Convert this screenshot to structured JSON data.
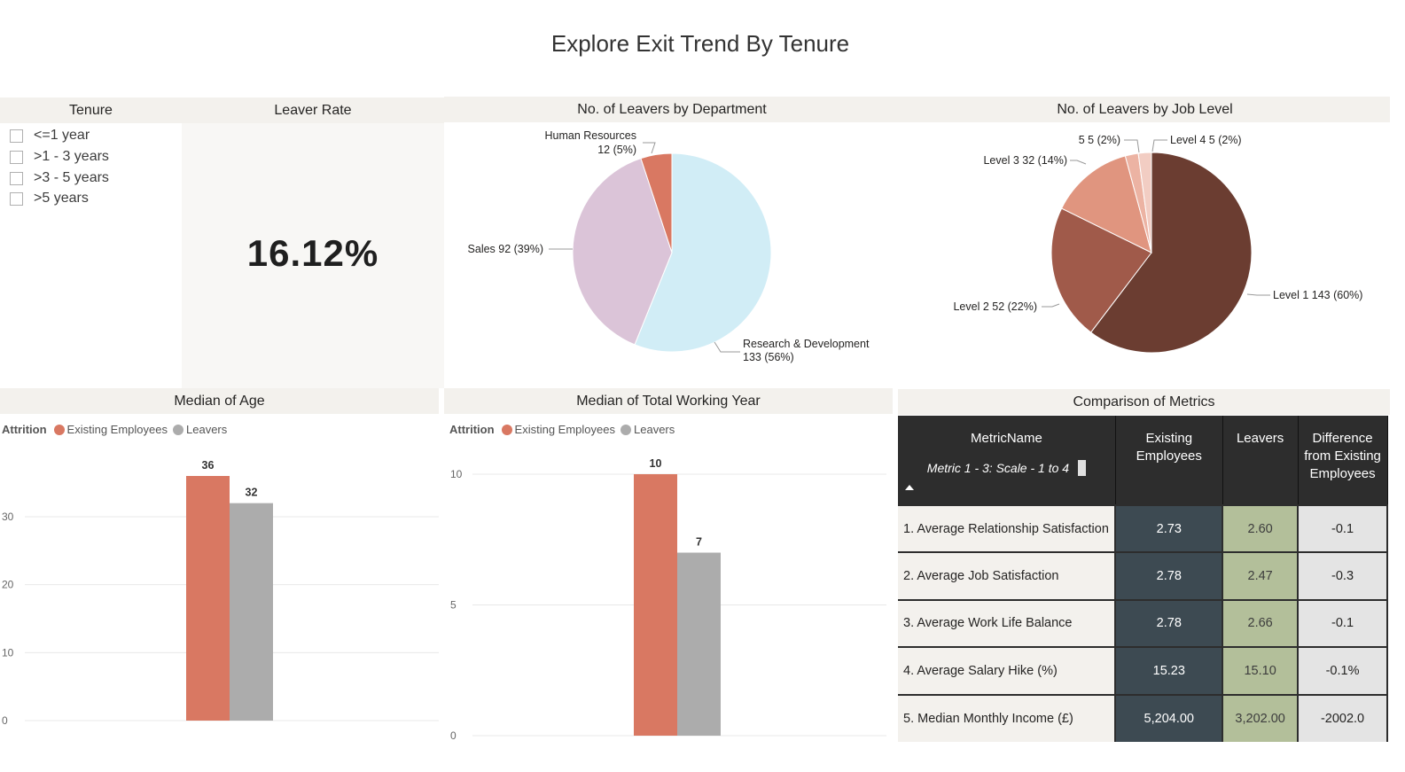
{
  "page": {
    "title": "Explore Exit Trend By Tenure"
  },
  "tenure": {
    "title": "Tenure",
    "options": [
      "<=1 year",
      ">1 - 3 years",
      ">3 - 5 years",
      ">5 years"
    ]
  },
  "leaver_rate": {
    "title": "Leaver Rate",
    "value": "16.12%"
  },
  "panels": {
    "dept_title": "No. of Leavers by Department",
    "level_title": "No. of Leavers by Job Level",
    "age_title": "Median of Age",
    "years_title": "Median of Total Working Year",
    "metrics_title": "Comparison of Metrics"
  },
  "legend": {
    "title": "Attrition",
    "existing": "Existing Employees",
    "leavers": "Leavers",
    "existing_color": "#d97862",
    "leavers_color": "#acacac"
  },
  "chart_data": [
    {
      "type": "pie",
      "title": "No. of Leavers by Department",
      "slices": [
        {
          "label": "Research & Development",
          "value": 133,
          "percent": "56%",
          "color": "#d1edf6",
          "text": "Research & Development",
          "text2": "133 (56%)"
        },
        {
          "label": "Sales",
          "value": 92,
          "percent": "39%",
          "color": "#dbc4d8",
          "text": "Sales 92 (39%)"
        },
        {
          "label": "Human Resources",
          "value": 12,
          "percent": "5%",
          "color": "#d97862",
          "text": "Human Resources",
          "text2": "12 (5%)"
        }
      ]
    },
    {
      "type": "pie",
      "title": "No. of Leavers by Job Level",
      "slices": [
        {
          "label": "Level 1",
          "value": 143,
          "percent": "60%",
          "color": "#6b3d31",
          "text": "Level 1 143 (60%)"
        },
        {
          "label": "Level 2",
          "value": 52,
          "percent": "22%",
          "color": "#a05a4a",
          "text": "Level 2 52 (22%)"
        },
        {
          "label": "Level 3",
          "value": 32,
          "percent": "14%",
          "color": "#e0957f",
          "text": "Level 3 32 (14%)"
        },
        {
          "label": "5",
          "value": 5,
          "percent": "2%",
          "color": "#ecb3a3",
          "text": "5 5 (2%)"
        },
        {
          "label": "Level 4",
          "value": 5,
          "percent": "2%",
          "color": "#f2cdc3",
          "text": "Level 4 5 (2%)"
        }
      ]
    },
    {
      "type": "bar",
      "title": "Median of Age",
      "categories": [
        "Existing Employees",
        "Leavers"
      ],
      "values": [
        36,
        32
      ],
      "ylim": [
        0,
        36
      ],
      "yticks": [
        "0",
        "10",
        "20",
        "30"
      ]
    },
    {
      "type": "bar",
      "title": "Median of Total Working Year",
      "categories": [
        "Existing Employees",
        "Leavers"
      ],
      "values": [
        10,
        7
      ],
      "ylim": [
        0,
        10
      ],
      "yticks": [
        "0",
        "5",
        "10"
      ]
    }
  ],
  "metrics": {
    "headers": {
      "name": "MetricName",
      "subheader": "Metric 1 - 3: Scale - 1 to 4",
      "existing_line1": "Existing",
      "existing_line2": "Employees",
      "leavers": "Leavers",
      "diff_line1": "Difference",
      "diff_line2": "from Existing",
      "diff_line3": "Employees"
    },
    "rows": [
      {
        "name": "1. Average Relationship Satisfaction",
        "existing": "2.73",
        "leavers": "2.60",
        "diff": "-0.1"
      },
      {
        "name": "2. Average Job Satisfaction",
        "existing": "2.78",
        "leavers": "2.47",
        "diff": "-0.3"
      },
      {
        "name": "3. Average Work Life Balance",
        "existing": "2.78",
        "leavers": "2.66",
        "diff": "-0.1"
      },
      {
        "name": "4. Average Salary Hike (%)",
        "existing": "15.23",
        "leavers": "15.10",
        "diff": "-0.1%"
      },
      {
        "name": "5. Median Monthly Income (£)",
        "existing": "5,204.00",
        "leavers": "3,202.00",
        "diff": "-2002.0"
      }
    ]
  }
}
